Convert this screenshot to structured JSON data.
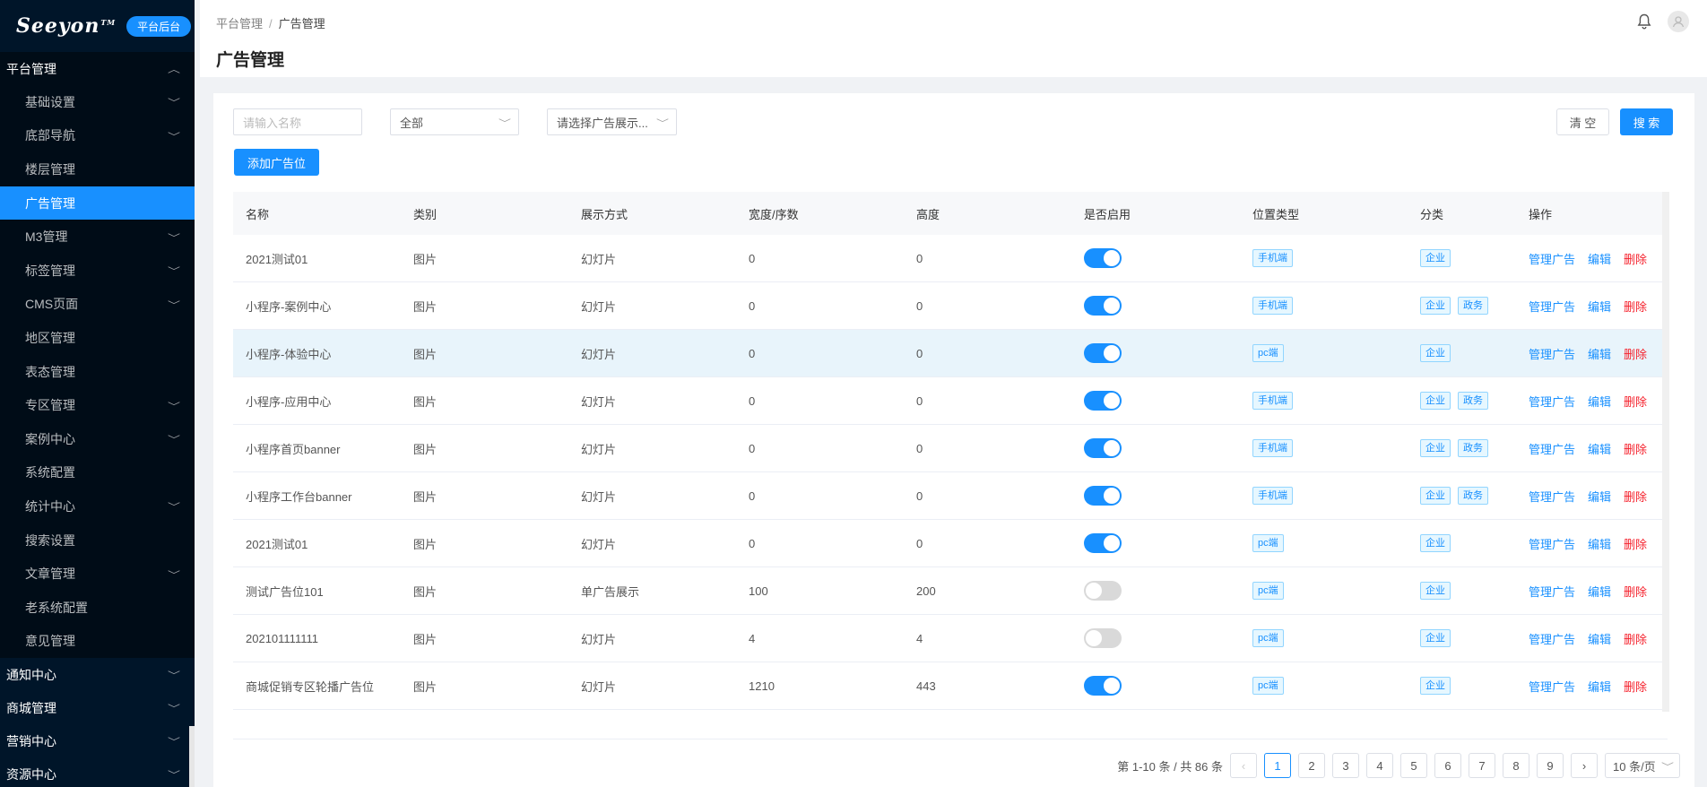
{
  "brand": {
    "logo": "Seeyon",
    "tm": "TM",
    "badge": "平台后台"
  },
  "sidebar": {
    "top_group": "平台管理",
    "items": [
      {
        "label": "基础设置",
        "chevron": true
      },
      {
        "label": "底部导航",
        "chevron": true
      },
      {
        "label": "楼层管理",
        "chevron": false
      },
      {
        "label": "广告管理",
        "chevron": false,
        "active": true
      },
      {
        "label": "M3管理",
        "chevron": true
      },
      {
        "label": "标签管理",
        "chevron": true
      },
      {
        "label": "CMS页面",
        "chevron": true
      },
      {
        "label": "地区管理",
        "chevron": false
      },
      {
        "label": "表态管理",
        "chevron": false
      },
      {
        "label": "专区管理",
        "chevron": true
      },
      {
        "label": "案例中心",
        "chevron": true
      },
      {
        "label": "系统配置",
        "chevron": false
      },
      {
        "label": "统计中心",
        "chevron": true
      },
      {
        "label": "搜索设置",
        "chevron": false
      },
      {
        "label": "文章管理",
        "chevron": true
      },
      {
        "label": "老系统配置",
        "chevron": false
      },
      {
        "label": "意见管理",
        "chevron": false
      }
    ],
    "groups": [
      "通知中心",
      "商城管理",
      "营销中心",
      "资源中心"
    ]
  },
  "header": {
    "breadcrumb": [
      "平台管理",
      "广告管理"
    ],
    "separator": "/",
    "title": "广告管理"
  },
  "filters": {
    "name_placeholder": "请输入名称",
    "category_value": "全部",
    "display_placeholder": "请选择广告展示...",
    "clear_label": "清 空",
    "search_label": "搜 索",
    "add_label": "添加广告位"
  },
  "table": {
    "columns": [
      "名称",
      "类别",
      "展示方式",
      "宽度/序数",
      "高度",
      "是否启用",
      "位置类型",
      "分类",
      "操作"
    ],
    "actions": {
      "manage": "管理广告",
      "edit": "编辑",
      "delete": "删除"
    },
    "rows": [
      {
        "name": "2021测试01",
        "type": "图片",
        "display": "幻灯片",
        "width": "0",
        "height": "0",
        "enabled": true,
        "position": "手机端",
        "categories": [
          "企业"
        ]
      },
      {
        "name": "小程序-案例中心",
        "type": "图片",
        "display": "幻灯片",
        "width": "0",
        "height": "0",
        "enabled": true,
        "position": "手机端",
        "categories": [
          "企业",
          "政务"
        ]
      },
      {
        "name": "小程序-体验中心",
        "type": "图片",
        "display": "幻灯片",
        "width": "0",
        "height": "0",
        "enabled": true,
        "position": "pc端",
        "categories": [
          "企业"
        ],
        "highlight": true
      },
      {
        "name": "小程序-应用中心",
        "type": "图片",
        "display": "幻灯片",
        "width": "0",
        "height": "0",
        "enabled": true,
        "position": "手机端",
        "categories": [
          "企业",
          "政务"
        ]
      },
      {
        "name": "小程序首页banner",
        "type": "图片",
        "display": "幻灯片",
        "width": "0",
        "height": "0",
        "enabled": true,
        "position": "手机端",
        "categories": [
          "企业",
          "政务"
        ]
      },
      {
        "name": "小程序工作台banner",
        "type": "图片",
        "display": "幻灯片",
        "width": "0",
        "height": "0",
        "enabled": true,
        "position": "手机端",
        "categories": [
          "企业",
          "政务"
        ]
      },
      {
        "name": "2021测试01",
        "type": "图片",
        "display": "幻灯片",
        "width": "0",
        "height": "0",
        "enabled": true,
        "position": "pc端",
        "categories": [
          "企业"
        ]
      },
      {
        "name": "测试广告位101",
        "type": "图片",
        "display": "单广告展示",
        "width": "100",
        "height": "200",
        "enabled": false,
        "position": "pc端",
        "categories": [
          "企业"
        ]
      },
      {
        "name": "202101111111",
        "type": "图片",
        "display": "幻灯片",
        "width": "4",
        "height": "4",
        "enabled": false,
        "position": "pc端",
        "categories": [
          "企业"
        ]
      },
      {
        "name": "商城促销专区轮播广告位",
        "type": "图片",
        "display": "幻灯片",
        "width": "1210",
        "height": "443",
        "enabled": true,
        "position": "pc端",
        "categories": [
          "企业"
        ]
      }
    ]
  },
  "pagination": {
    "summary": "第 1-10 条 / 共 86 条",
    "prev": "‹",
    "next": "›",
    "pages": [
      "1",
      "2",
      "3",
      "4",
      "5",
      "6",
      "7",
      "8",
      "9"
    ],
    "current": "1",
    "page_size": "10 条/页"
  },
  "colors": {
    "primary": "#1890ff",
    "sidebar_bg": "#001529",
    "danger": "#f5222d"
  }
}
